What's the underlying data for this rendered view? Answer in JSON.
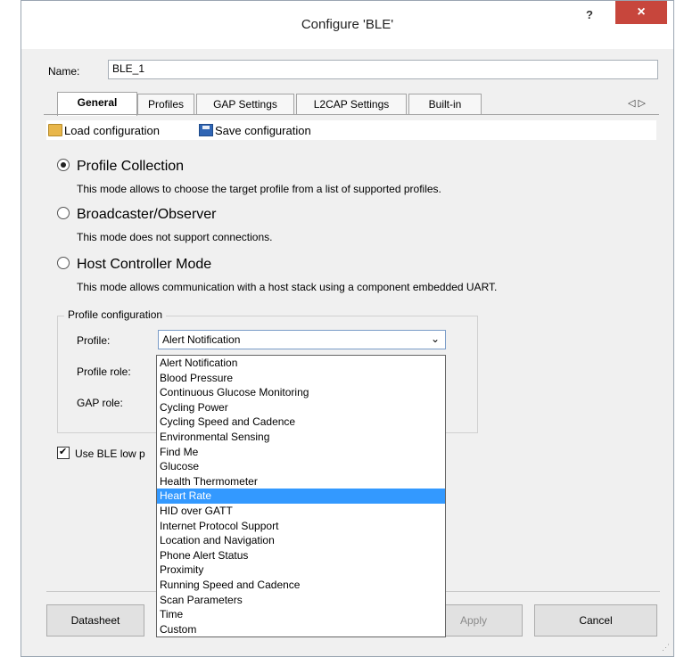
{
  "window": {
    "title": "Configure 'BLE'",
    "help_label": "?",
    "close_label": "×"
  },
  "name_field": {
    "label": "Name:",
    "value": "BLE_1"
  },
  "tabs": [
    {
      "label": "General",
      "active": true
    },
    {
      "label": "Profiles"
    },
    {
      "label": "GAP Settings"
    },
    {
      "label": "L2CAP Settings"
    },
    {
      "label": "Built-in"
    }
  ],
  "tab_scroll": "◁ ▷",
  "toolbar": {
    "load_label": "Load configuration",
    "save_label": "Save configuration"
  },
  "modes": [
    {
      "label": "Profile Collection",
      "description": "This mode allows to choose the target profile from a list of supported profiles.",
      "selected": true
    },
    {
      "label": "Broadcaster/Observer",
      "description": "This mode does not support connections.",
      "selected": false
    },
    {
      "label": "Host Controller Mode",
      "description": "This mode allows communication with a host stack using a component embedded UART.",
      "selected": false
    }
  ],
  "profile_config": {
    "title": "Profile configuration",
    "profile_label": "Profile:",
    "profile_role_label": "Profile role:",
    "gap_role_label": "GAP role:",
    "selected_profile": "Alert Notification"
  },
  "dropdown_options": [
    "Alert Notification",
    "Blood Pressure",
    "Continuous Glucose Monitoring",
    "Cycling Power",
    "Cycling Speed and Cadence",
    "Environmental Sensing",
    "Find Me",
    "Glucose",
    "Health Thermometer",
    "Heart Rate",
    "HID over GATT",
    "Internet Protocol Support",
    "Location and Navigation",
    "Phone Alert Status",
    "Proximity",
    "Running Speed and Cadence",
    "Scan Parameters",
    "Time",
    "Custom"
  ],
  "highlighted_option": "Heart Rate",
  "low_power": {
    "label": "Use BLE low p",
    "checked": true
  },
  "buttons": {
    "datasheet": "Datasheet",
    "apply": "Apply",
    "cancel": "Cancel"
  },
  "colors": {
    "highlight": "#3399ff",
    "close": "#c7463c"
  }
}
